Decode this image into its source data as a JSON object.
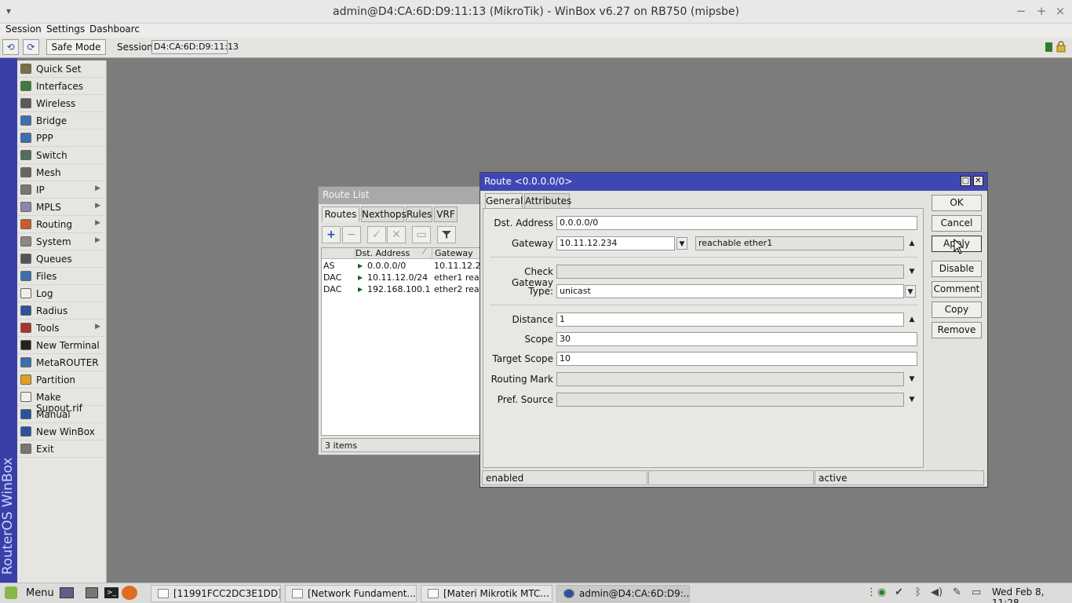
{
  "window": {
    "title": "admin@D4:CA:6D:D9:11:13 (MikroTik) - WinBox v6.27 on RB750 (mipsbe)",
    "minimize": "−",
    "maximize": "+",
    "close": "×"
  },
  "menubar": {
    "session": "Session",
    "settings": "Settings",
    "dashboard": "Dashboarc"
  },
  "toolbar": {
    "undo": "⟲",
    "redo": "⟳",
    "safe_mode": "Safe Mode",
    "session_label": "Session:",
    "session_value": "D4:CA:6D:D9:11:13"
  },
  "brand": "RouterOS WinBox",
  "sidemenu": {
    "items": [
      {
        "label": "Quick Set",
        "icon": "quick-set-icon",
        "color": "#7a6f4a",
        "sub": false
      },
      {
        "label": "Interfaces",
        "icon": "interfaces-icon",
        "color": "#3a7d3a",
        "sub": false
      },
      {
        "label": "Wireless",
        "icon": "wireless-icon",
        "color": "#5a5a5a",
        "sub": false
      },
      {
        "label": "Bridge",
        "icon": "bridge-icon",
        "color": "#3a6fb0",
        "sub": false
      },
      {
        "label": "PPP",
        "icon": "ppp-icon",
        "color": "#3a6fb0",
        "sub": false
      },
      {
        "label": "Switch",
        "icon": "switch-icon",
        "color": "#4f6f5a",
        "sub": false
      },
      {
        "label": "Mesh",
        "icon": "mesh-icon",
        "color": "#666666",
        "sub": false
      },
      {
        "label": "IP",
        "icon": "ip-icon",
        "color": "#777777",
        "sub": true
      },
      {
        "label": "MPLS",
        "icon": "mpls-icon",
        "color": "#8888aa",
        "sub": true
      },
      {
        "label": "Routing",
        "icon": "routing-icon",
        "color": "#cc5a2a",
        "sub": true
      },
      {
        "label": "System",
        "icon": "system-icon",
        "color": "#888888",
        "sub": true
      },
      {
        "label": "Queues",
        "icon": "queues-icon",
        "color": "#555555",
        "sub": false
      },
      {
        "label": "Files",
        "icon": "files-icon",
        "color": "#3a6fb0",
        "sub": false
      },
      {
        "label": "Log",
        "icon": "log-icon",
        "color": "#eeeeee",
        "sub": false
      },
      {
        "label": "Radius",
        "icon": "radius-icon",
        "color": "#2a52a0",
        "sub": false
      },
      {
        "label": "Tools",
        "icon": "tools-icon",
        "color": "#b03030",
        "sub": true
      },
      {
        "label": "New Terminal",
        "icon": "terminal-icon",
        "color": "#222222",
        "sub": false
      },
      {
        "label": "MetaROUTER",
        "icon": "metarouter-icon",
        "color": "#3a6fb0",
        "sub": false
      },
      {
        "label": "Partition",
        "icon": "partition-icon",
        "color": "#e0a020",
        "sub": false
      },
      {
        "label": "Make Supout.rif",
        "icon": "supout-icon",
        "color": "#eeeeee",
        "sub": false
      },
      {
        "label": "Manual",
        "icon": "manual-icon",
        "color": "#2a52a0",
        "sub": false
      },
      {
        "label": "New WinBox",
        "icon": "winbox-icon",
        "color": "#2a52a0",
        "sub": false
      },
      {
        "label": "Exit",
        "icon": "exit-icon",
        "color": "#777777",
        "sub": false
      }
    ]
  },
  "route_list": {
    "title": "Route List",
    "tabs": [
      "Routes",
      "Nexthops",
      "Rules",
      "VRF"
    ],
    "columns": [
      "Dst. Address",
      "Gateway"
    ],
    "rows": [
      {
        "flags": "AS",
        "dst": "0.0.0.0/0",
        "gateway": "10.11.12.234"
      },
      {
        "flags": "DAC",
        "dst": "10.11.12.0/24",
        "gateway": "ether1 reachable"
      },
      {
        "flags": "DAC",
        "dst": "192.168.100.1",
        "gateway": "ether2 reachable"
      }
    ],
    "footer": "3 items",
    "sort_marker": "⁄"
  },
  "route_dialog": {
    "title": "Route <0.0.0.0/0>",
    "tabs": [
      "General",
      "Attributes"
    ],
    "fields": {
      "dst_address": {
        "label": "Dst. Address",
        "value": "0.0.0.0/0"
      },
      "gateway": {
        "label": "Gateway",
        "value": "10.11.12.234",
        "status": "reachable ether1"
      },
      "check_gateway": {
        "label": "Check Gateway",
        "value": ""
      },
      "type": {
        "label": "Type:",
        "value": "unicast"
      },
      "distance": {
        "label": "Distance",
        "value": "1"
      },
      "scope": {
        "label": "Scope",
        "value": "30"
      },
      "target_scope": {
        "label": "Target Scope",
        "value": "10"
      },
      "routing_mark": {
        "label": "Routing Mark",
        "value": ""
      },
      "pref_source": {
        "label": "Pref. Source",
        "value": ""
      }
    },
    "buttons": {
      "ok": "OK",
      "cancel": "Cancel",
      "apply": "Apply",
      "disable": "Disable",
      "comment": "Comment",
      "copy": "Copy",
      "remove": "Remove"
    },
    "status": {
      "left": "enabled",
      "middle": "",
      "right": "active"
    }
  },
  "taskbar": {
    "menu": "Menu",
    "tasks": [
      {
        "label": "[11991FCC2DC3E1DD]"
      },
      {
        "label": "[Network Fundament..."
      },
      {
        "label": "[Materi Mikrotik MTC..."
      },
      {
        "label": "admin@D4:CA:6D:D9:..."
      }
    ],
    "clock": "Wed Feb 8, 11:28"
  }
}
